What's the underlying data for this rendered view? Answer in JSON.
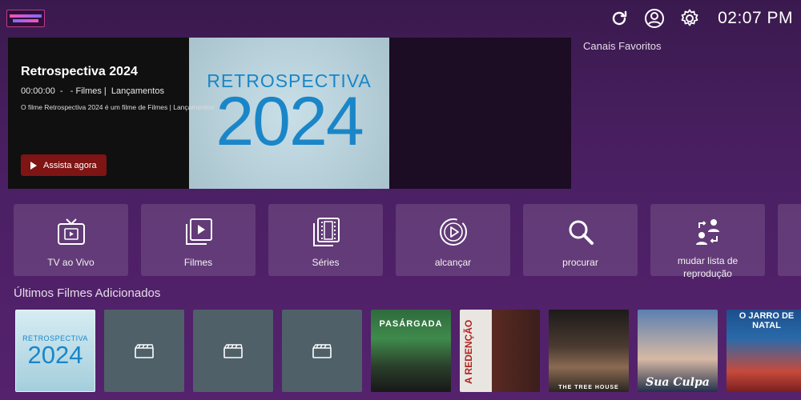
{
  "header": {
    "clock": "02:07 PM",
    "icons": [
      "refresh-icon",
      "account-icon",
      "settings-icon"
    ]
  },
  "hero": {
    "title": "Retrospectiva 2024",
    "meta": "00:00:00  -   - Filmes |  Lançamentos",
    "description": "O filme Retrospectiva 2024 é um filme de Filmes |  Lançamentos",
    "watch_label": "Assista agora",
    "poster_word": "RETROSPECTIVA",
    "poster_year": "2024"
  },
  "favorites": {
    "label": "Canais Favoritos"
  },
  "categories": [
    {
      "label": "TV ao Vivo",
      "icon": "tv-icon"
    },
    {
      "label": "Filmes",
      "icon": "movies-icon"
    },
    {
      "label": "Séries",
      "icon": "series-icon"
    },
    {
      "label": "alcançar",
      "icon": "catchup-icon"
    },
    {
      "label": "procurar",
      "icon": "search-icon"
    },
    {
      "label": "mudar lista de reprodução",
      "icon": "switch-playlist-icon"
    }
  ],
  "latest_movies": {
    "title": "Últimos Filmes Adicionados",
    "posters": [
      {
        "word": "RETROSPECTIVA",
        "year": "2024"
      },
      {
        "placeholder": true
      },
      {
        "placeholder": true
      },
      {
        "placeholder": true
      },
      {
        "text": "PASÁRGADA"
      },
      {
        "text": "A REDENÇÃO"
      },
      {
        "text": "THE TREE HOUSE"
      },
      {
        "text": "Sua Culpa"
      },
      {
        "text": "O JARRO DE NATAL"
      }
    ]
  },
  "colors": {
    "background": "#4a1f62",
    "watch_button": "#7e1414",
    "tile": "rgba(255,255,255,0.12)",
    "placeholder": "#4f6068"
  }
}
